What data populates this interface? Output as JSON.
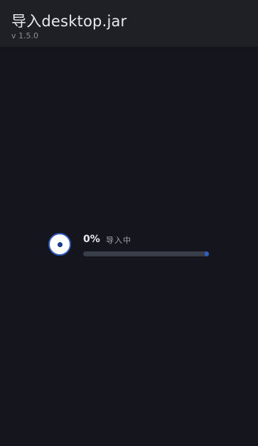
{
  "header": {
    "title": "导入desktop.jar",
    "version": "v 1.5.0"
  },
  "progress": {
    "percent_label": "0%",
    "status": "导入中",
    "value": 0
  },
  "colors": {
    "background": "#15161d",
    "titlebar": "#1f2026",
    "accent": "#2b56b8",
    "track": "#3a3e4a"
  },
  "icons": {
    "status_icon": "radio-dot-icon"
  }
}
